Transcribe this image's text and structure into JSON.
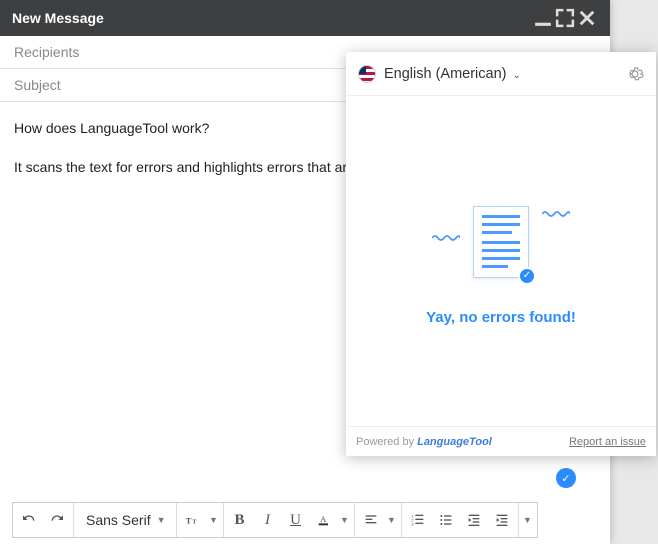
{
  "window": {
    "title": "New Message"
  },
  "fields": {
    "recipients_placeholder": "Recipients",
    "subject_placeholder": "Subject"
  },
  "body": {
    "line1": "How does LanguageTool work?",
    "line2": "It scans the text for errors and highlights errors that are d"
  },
  "toolbar": {
    "font_family": "Sans Serif"
  },
  "lt": {
    "language": "English (American)",
    "success_msg": "Yay, no errors found!",
    "powered_by_prefix": "Powered by",
    "powered_by_brand": "LanguageTool",
    "report_label": "Report an issue"
  }
}
